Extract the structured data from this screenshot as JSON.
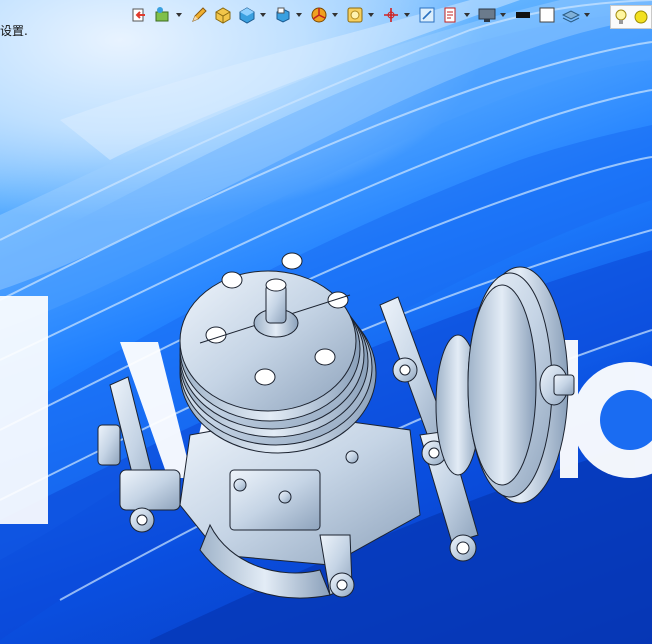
{
  "status": {
    "text": "设置."
  },
  "toolbar": {
    "buttons": [
      {
        "id": "exit-sketch",
        "icon": "exit-arrow-icon",
        "dropdown": false
      },
      {
        "id": "view-orient",
        "icon": "view-orientation-icon",
        "dropdown": true
      },
      {
        "id": "sketch-pencil",
        "icon": "pencil-icon",
        "dropdown": false
      },
      {
        "id": "section-view",
        "icon": "section-cube-icon",
        "dropdown": false
      },
      {
        "id": "display-style",
        "icon": "shaded-cube-icon",
        "dropdown": true
      },
      {
        "id": "hide-show",
        "icon": "hide-show-icon",
        "dropdown": true
      },
      {
        "id": "appearance",
        "icon": "appearance-pie-icon",
        "dropdown": true
      },
      {
        "id": "scene",
        "icon": "scene-icon",
        "dropdown": true
      },
      {
        "id": "triad",
        "icon": "triad-axes-icon",
        "dropdown": true
      },
      {
        "id": "zoom-fit",
        "icon": "zoom-fit-icon",
        "dropdown": false
      },
      {
        "id": "view-settings",
        "icon": "view-settings-icon",
        "dropdown": true
      },
      {
        "id": "monitor",
        "icon": "monitor-icon",
        "dropdown": true
      },
      {
        "id": "black-bar",
        "icon": "black-bar-icon",
        "dropdown": false
      },
      {
        "id": "frame",
        "icon": "frame-square-icon",
        "dropdown": false
      },
      {
        "id": "layers",
        "icon": "layers-icon",
        "dropdown": true
      }
    ],
    "end_icons": [
      "lightbulb-icon",
      "sun-icon"
    ]
  },
  "colors": {
    "accent": "#1f7fff",
    "model_fill": "#c8d6e6",
    "model_stroke": "#1c2330"
  }
}
